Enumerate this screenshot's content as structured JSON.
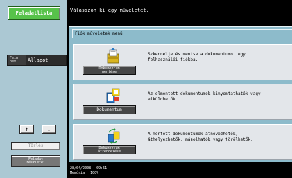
{
  "sidebar": {
    "tasks_label": "Feladatlista",
    "job_small_label": "Fein nev",
    "job_status_label": "Állapot",
    "delete_label": "Törlés",
    "details_label": "Feladat\nrészletei",
    "arrow_up": "↑",
    "arrow_down": "↓"
  },
  "main": {
    "message": "Válasszon ki egy műveletet.",
    "panel_title": "Fiók műveletek menü",
    "options": [
      {
        "icon": "folder-save-icon",
        "button_label": "Dokumentum\nmentése",
        "description": "Szkennelje és mentse a dokumentumot egy\nfelhasználói fiókba."
      },
      {
        "icon": "document-print-icon",
        "button_label": "Dokumentum",
        "description": "Az elmentett dokumentumok kinyomtathatók vagy\nelküldhetők."
      },
      {
        "icon": "document-arrange-icon",
        "button_label": "Dokumentum\nátrendezése",
        "description": "A mentett dokumentumok átnevezhetők,\náthelyezhetők, másolhatók vagy törölhetők."
      }
    ]
  },
  "footer": {
    "date": "28/04/2008",
    "time": "09:51",
    "memory_label": "Memória",
    "memory_value": "100%"
  },
  "colors": {
    "tasks_button": "#57c24a",
    "panel_background": "#8dbbcb",
    "sidebar_background": "#abc8d3"
  }
}
